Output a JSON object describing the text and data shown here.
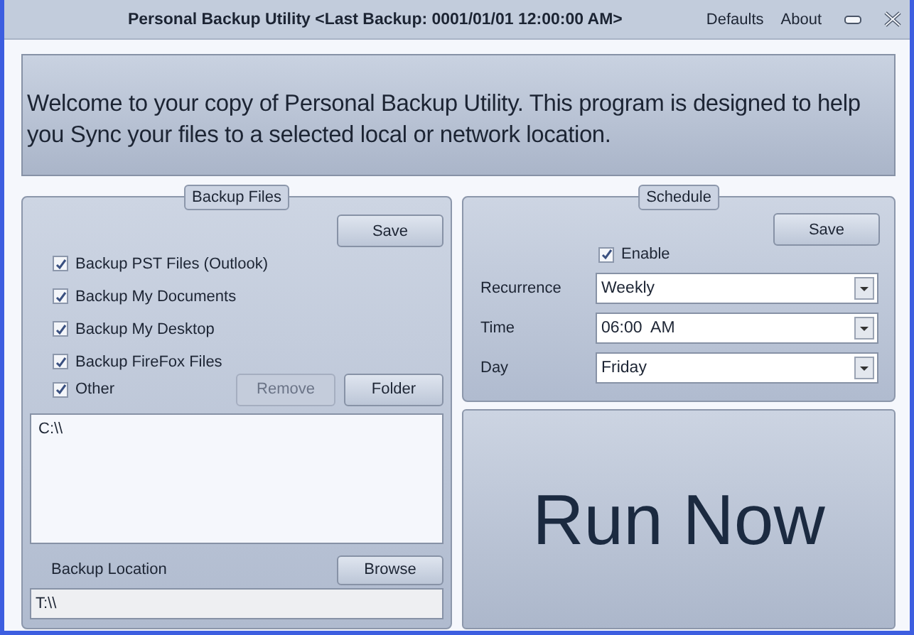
{
  "window": {
    "title": "Personal Backup Utility <Last Backup: 0001/01/01 12:00:00 AM>",
    "menu": [
      "Defaults",
      "About"
    ]
  },
  "banner": {
    "text": "Welcome to your copy of Personal Backup Utility. This program is designed to help you Sync your files to a selected local or network location."
  },
  "backup_files": {
    "title": "Backup Files",
    "save": "Save",
    "options": [
      {
        "label": "Backup PST Files (Outlook)",
        "checked": true
      },
      {
        "label": "Backup My Documents",
        "checked": true
      },
      {
        "label": "Backup My Desktop",
        "checked": true
      },
      {
        "label": "Backup FireFox Files",
        "checked": true
      },
      {
        "label": "Other",
        "checked": true
      }
    ],
    "remove": {
      "label": "Remove",
      "disabled": true
    },
    "folder": {
      "label": "Folder",
      "disabled": false
    },
    "list": [
      "C:\\\\"
    ],
    "location_label": "Backup Location",
    "browse": "Browse",
    "location_value": "T:\\\\"
  },
  "schedule": {
    "title": "Schedule",
    "save": "Save",
    "enable": {
      "label": "Enable",
      "checked": true
    },
    "fields": [
      {
        "label": "Recurrence",
        "value": "Weekly"
      },
      {
        "label": "Time",
        "value": "06:00  AM"
      },
      {
        "label": "Day",
        "value": "Friday"
      }
    ]
  },
  "run_now": "Run Now"
}
